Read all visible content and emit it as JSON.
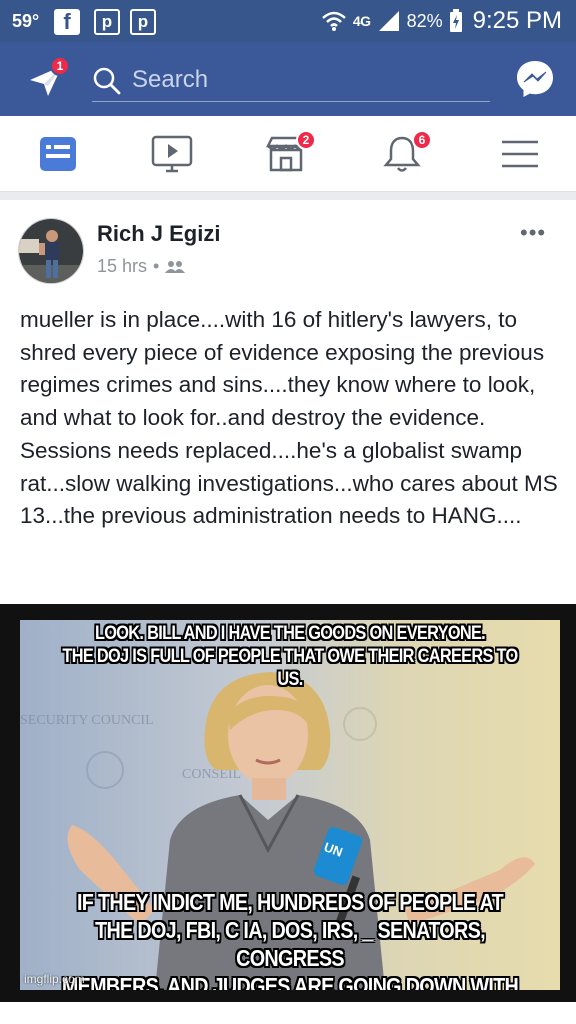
{
  "status_bar": {
    "temperature": "59°",
    "network": "4G",
    "battery": "82%",
    "time": "9:25 PM",
    "notification_icons": [
      "facebook-icon",
      "pinterest-icon",
      "pinterest-icon"
    ]
  },
  "header": {
    "plane_badge": "1",
    "search_placeholder": "Search",
    "brand_color": "#3b5998"
  },
  "tabs": [
    {
      "name": "news-feed",
      "icon": "news-feed-icon",
      "active": true
    },
    {
      "name": "watch",
      "icon": "video-icon"
    },
    {
      "name": "marketplace",
      "icon": "marketplace-icon",
      "badge": "2"
    },
    {
      "name": "notifications",
      "icon": "bell-icon",
      "badge": "6"
    },
    {
      "name": "menu",
      "icon": "hamburger-icon"
    }
  ],
  "post": {
    "author": "Rich J Egizi",
    "time": "15 hrs",
    "audience_icon": "friends-icon",
    "text": "mueller is in place....with 16 of hitlery's lawyers, to shred every piece of evidence exposing the previous regimes crimes and sins....they know where to look, and what to look for..and destroy the evidence.  Sessions needs replaced....he's a globalist swamp rat...slow walking investigations...who cares about MS 13...the previous administration needs to HANG....",
    "meme": {
      "caption_top_line1": "LOOK. BILL AND I HAVE THE GOODS ON EVERYONE.",
      "caption_top_line2": "THE DOJ IS FULL OF PEOPLE THAT OWE THEIR CAREERS TO US.",
      "caption_bottom_line1": "IF THEY INDICT ME, HUNDREDS OF PEOPLE AT",
      "caption_bottom_line2": "THE DOJ, FBI, C IA, DOS, IRS, _ SENATORS, CONGRESS",
      "caption_bottom_line3": "MEMBERS, AND JUDGES ARE GOING DOWN WITH ME.",
      "watermark": "imgflip.com",
      "background_text": [
        "SECURITY COUNCIL",
        "CONSEIL",
        "UN"
      ]
    }
  },
  "colors": {
    "badge": "#f02849",
    "status_bar": "#36568c",
    "text": "#1d2129",
    "meta": "#90949c"
  }
}
